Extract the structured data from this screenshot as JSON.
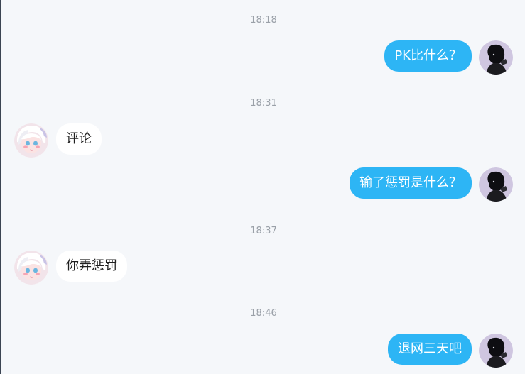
{
  "messages": [
    {
      "timestamp": "18:18",
      "text": "PK比什么？",
      "direction": "outgoing",
      "avatar": "sender-avatar"
    },
    {
      "timestamp": "18:31",
      "text": "评论",
      "direction": "incoming",
      "avatar": "receiver-avatar"
    },
    {
      "timestamp": "",
      "text": "输了惩罚是什么？",
      "direction": "outgoing",
      "avatar": "sender-avatar"
    },
    {
      "timestamp": "18:37",
      "text": "你弄惩罚",
      "direction": "incoming",
      "avatar": "receiver-avatar"
    },
    {
      "timestamp": "18:46",
      "text": "退网三天吧",
      "direction": "outgoing",
      "avatar": "sender-avatar"
    }
  ],
  "colors": {
    "background": "#f5f7fa",
    "outgoing_bubble": "#2db5f5",
    "incoming_bubble": "#ffffff",
    "timestamp_text": "#9aa0a8"
  }
}
